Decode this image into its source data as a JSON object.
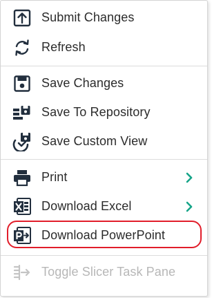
{
  "menu": {
    "items": [
      {
        "label": "Submit Changes",
        "icon": "upload-arrow-icon"
      },
      {
        "label": "Refresh",
        "icon": "refresh-icon"
      },
      {
        "label": "Save Changes",
        "icon": "save-icon"
      },
      {
        "label": "Save To Repository",
        "icon": "save-to-repository-icon"
      },
      {
        "label": "Save Custom View",
        "icon": "save-custom-view-icon"
      },
      {
        "label": "Print",
        "icon": "printer-icon",
        "has_submenu": true
      },
      {
        "label": "Download Excel",
        "icon": "excel-icon",
        "has_submenu": true
      },
      {
        "label": "Download PowerPoint",
        "icon": "powerpoint-icon",
        "highlighted": true
      },
      {
        "label": "Toggle Slicer Task Pane",
        "icon": "slicer-pane-icon",
        "disabled": true
      }
    ]
  },
  "colors": {
    "icon": "#222f3e",
    "chevron": "#17a589",
    "disabled_text": "#b7b7b7",
    "highlight_outline": "#e11d2a",
    "divider": "#dcdcdc"
  }
}
